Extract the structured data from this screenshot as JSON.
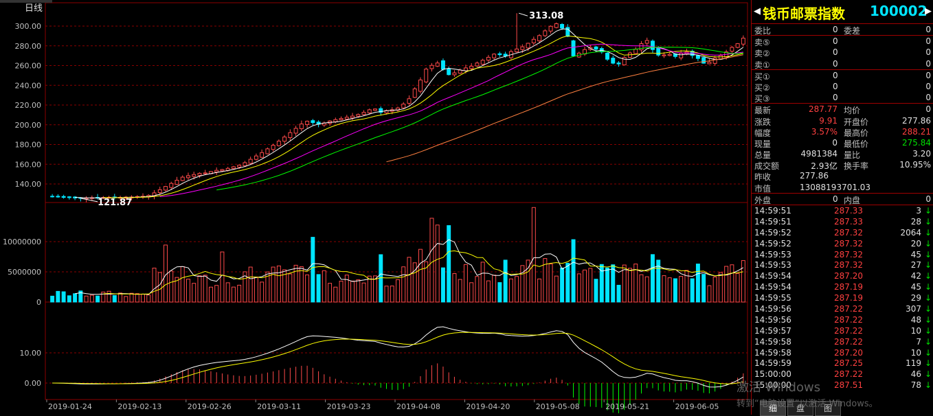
{
  "chart": {
    "period_label": "日线",
    "peak_label": "313.08",
    "trough_label": "121.87",
    "price_ticks": [
      "300.00",
      "280.00",
      "260.00",
      "240.00",
      "220.00",
      "200.00",
      "180.00",
      "160.00",
      "140.00"
    ],
    "vol_ticks": [
      "10000000",
      "5000000",
      "0"
    ],
    "macd_ticks": [
      "10.00",
      "0.00"
    ],
    "dates": [
      "2019-01-24",
      "2019-02-13",
      "2019-02-26",
      "2019-03-11",
      "2019-03-23",
      "2019-04-08",
      "2019-04-20",
      "2019-05-08",
      "2019-05-21",
      "2019-06-05"
    ]
  },
  "colors": {
    "up": "#ff4a4a",
    "down": "#00e5ff",
    "grid": "#8b0000",
    "ma5": "#ffffff",
    "ma10": "#ffff00",
    "ma20": "#ff00ff",
    "ma30": "#00ff00",
    "ma60": "#ff8040"
  },
  "chart_data": {
    "type": "candlestick",
    "close": [
      127.1,
      126.8,
      126.4,
      126.2,
      125.8,
      125.6,
      125.8,
      126.1,
      126.0,
      126.3,
      126.5,
      126.2,
      126.4,
      126.7,
      126.8,
      127.2,
      127.5,
      128.4,
      131.0,
      134.2,
      137.5,
      140.6,
      143.8,
      146.9,
      148.4,
      149.6,
      150.8,
      151.2,
      152.6,
      153.8,
      154.6,
      155.8,
      157.4,
      159.0,
      161.6,
      165.0,
      168.4,
      171.8,
      175.6,
      179.2,
      183.4,
      187.6,
      192.0,
      196.4,
      200.8,
      203.6,
      202.2,
      200.6,
      201.8,
      203.8,
      205.2,
      206.4,
      207.6,
      208.8,
      210.4,
      212.6,
      215.2,
      216.0,
      212.6,
      214.4,
      215.2,
      217.0,
      221.0,
      226.4,
      236.4,
      245.4,
      256.4,
      260.2,
      262.6,
      256.2,
      250.8,
      252.6,
      255.4,
      257.6,
      259.4,
      262.6,
      265.4,
      268.4,
      271.6,
      271.0,
      269.8,
      274.2,
      276.8,
      279.0,
      282.6,
      286.6,
      290.4,
      295.2,
      299.8,
      302.4,
      298.0,
      289.6,
      269.8,
      272.6,
      276.2,
      278.4,
      276.6,
      273.8,
      266.4,
      262.4,
      261.6,
      268.2,
      272.8,
      276.6,
      282.2,
      285.4,
      276.2,
      270.6,
      270.8,
      271.4,
      269.2,
      272.4,
      273.8,
      270.2,
      267.2,
      262.4,
      263.4,
      267.6,
      270.2,
      273.8,
      278.4,
      282.2,
      287.77
    ]
  },
  "side": {
    "name": "钱币邮票指数",
    "code": "100002",
    "weibi_label": "委比",
    "weibi_val": "0",
    "weicha_label": "委差",
    "weicha_val": "0",
    "sells": [
      {
        "label": "卖⑤",
        "price": "0",
        "vol": "0"
      },
      {
        "label": "卖②",
        "price": "0",
        "vol": "0"
      },
      {
        "label": "卖①",
        "price": "0",
        "vol": "0"
      }
    ],
    "buys": [
      {
        "label": "买①",
        "price": "0",
        "vol": "0"
      },
      {
        "label": "买②",
        "price": "0",
        "vol": "0"
      },
      {
        "label": "买③",
        "price": "0",
        "vol": "0"
      }
    ],
    "quote": [
      {
        "l1": "最新",
        "v1": "287.77",
        "c1": "red",
        "l2": "均价",
        "v2": "0",
        "c2": "white"
      },
      {
        "l1": "涨跌",
        "v1": "9.91",
        "c1": "red",
        "l2": "开盘价",
        "v2": "277.86",
        "c2": "white"
      },
      {
        "l1": "幅度",
        "v1": "3.57%",
        "c1": "red",
        "l2": "最高价",
        "v2": "288.21",
        "c2": "red"
      },
      {
        "l1": "现量",
        "v1": "0",
        "c1": "white",
        "l2": "最低价",
        "v2": "275.84",
        "c2": "green"
      },
      {
        "l1": "总量",
        "v1": "4981384",
        "c1": "white",
        "l2": "量比",
        "v2": "3.20",
        "c2": "white"
      },
      {
        "l1": "成交额",
        "v1": "2.93亿",
        "c1": "white",
        "l2": "换手率",
        "v2": "10.95%",
        "c2": "white"
      },
      {
        "l1": "昨收",
        "v1": "277.86",
        "c1": "white",
        "l2": "",
        "v2": "",
        "c2": "white"
      },
      {
        "l1": "市值",
        "v1": "13088193701.03",
        "c1": "white",
        "l2": "",
        "v2": "",
        "c2": "white"
      }
    ],
    "waipan_label": "外盘",
    "waipan_val": "0",
    "neipan_label": "内盘",
    "neipan_val": "0",
    "ticks": [
      {
        "t": "14:59:51",
        "p": "287.33",
        "v": "3"
      },
      {
        "t": "14:59:51",
        "p": "287.33",
        "v": "28"
      },
      {
        "t": "14:59:52",
        "p": "287.32",
        "v": "2064"
      },
      {
        "t": "14:59:52",
        "p": "287.32",
        "v": "20"
      },
      {
        "t": "14:59:53",
        "p": "287.32",
        "v": "45"
      },
      {
        "t": "14:59:53",
        "p": "287.32",
        "v": "27"
      },
      {
        "t": "14:59:54",
        "p": "287.20",
        "v": "42"
      },
      {
        "t": "14:59:54",
        "p": "287.19",
        "v": "45"
      },
      {
        "t": "14:59:55",
        "p": "287.19",
        "v": "29"
      },
      {
        "t": "14:59:56",
        "p": "287.22",
        "v": "307"
      },
      {
        "t": "14:59:56",
        "p": "287.22",
        "v": "48"
      },
      {
        "t": "14:59:57",
        "p": "287.22",
        "v": "10"
      },
      {
        "t": "14:59:58",
        "p": "287.22",
        "v": "7"
      },
      {
        "t": "14:59:58",
        "p": "287.20",
        "v": "10"
      },
      {
        "t": "14:59:59",
        "p": "287.25",
        "v": "119"
      },
      {
        "t": "15:00:00",
        "p": "287.22",
        "v": "46"
      },
      {
        "t": "15:00:00",
        "p": "287.51",
        "v": "78"
      }
    ],
    "tabs": [
      "细",
      "盘",
      "图"
    ],
    "watermark1": "激活 Windows",
    "watermark2": "转到“电脑设置”以激活 Windows。"
  }
}
